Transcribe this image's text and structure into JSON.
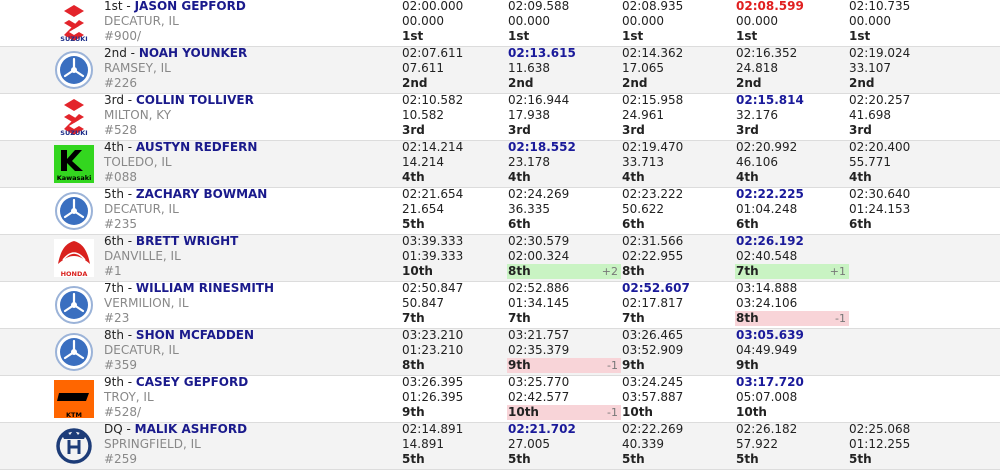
{
  "riders": [
    {
      "pos": "1st",
      "name": "JASON GEPFORD",
      "location": "DECATUR, IL",
      "number": "#900/",
      "brand": "suzuki",
      "laps": [
        {
          "time": "02:00.000",
          "elapsed": "00.000",
          "place": "1st"
        },
        {
          "time": "02:09.588",
          "elapsed": "00.000",
          "place": "1st"
        },
        {
          "time": "02:08.935",
          "elapsed": "00.000",
          "place": "1st"
        },
        {
          "time": "02:08.599",
          "elapsed": "00.000",
          "place": "1st",
          "fastest": true
        },
        {
          "time": "02:10.735",
          "elapsed": "00.000",
          "place": "1st"
        }
      ]
    },
    {
      "pos": "2nd",
      "name": "NOAH YOUNKER",
      "location": "RAMSEY, IL",
      "number": "#226",
      "brand": "yamaha",
      "laps": [
        {
          "time": "02:07.611",
          "elapsed": "07.611",
          "place": "2nd"
        },
        {
          "time": "02:13.615",
          "elapsed": "11.638",
          "place": "2nd",
          "best": true
        },
        {
          "time": "02:14.362",
          "elapsed": "17.065",
          "place": "2nd"
        },
        {
          "time": "02:16.352",
          "elapsed": "24.818",
          "place": "2nd"
        },
        {
          "time": "02:19.024",
          "elapsed": "33.107",
          "place": "2nd"
        }
      ]
    },
    {
      "pos": "3rd",
      "name": "COLLIN TOLLIVER",
      "location": "MILTON, KY",
      "number": "#528",
      "brand": "suzuki",
      "laps": [
        {
          "time": "02:10.582",
          "elapsed": "10.582",
          "place": "3rd"
        },
        {
          "time": "02:16.944",
          "elapsed": "17.938",
          "place": "3rd"
        },
        {
          "time": "02:15.958",
          "elapsed": "24.961",
          "place": "3rd"
        },
        {
          "time": "02:15.814",
          "elapsed": "32.176",
          "place": "3rd",
          "best": true
        },
        {
          "time": "02:20.257",
          "elapsed": "41.698",
          "place": "3rd"
        }
      ]
    },
    {
      "pos": "4th",
      "name": "AUSTYN REDFERN",
      "location": "TOLEDO, IL",
      "number": "#088",
      "brand": "kawasaki",
      "laps": [
        {
          "time": "02:14.214",
          "elapsed": "14.214",
          "place": "4th"
        },
        {
          "time": "02:18.552",
          "elapsed": "23.178",
          "place": "4th",
          "best": true
        },
        {
          "time": "02:19.470",
          "elapsed": "33.713",
          "place": "4th"
        },
        {
          "time": "02:20.992",
          "elapsed": "46.106",
          "place": "4th"
        },
        {
          "time": "02:20.400",
          "elapsed": "55.771",
          "place": "4th"
        }
      ]
    },
    {
      "pos": "5th",
      "name": "ZACHARY BOWMAN",
      "location": "DECATUR, IL",
      "number": "#235",
      "brand": "yamaha",
      "laps": [
        {
          "time": "02:21.654",
          "elapsed": "21.654",
          "place": "5th"
        },
        {
          "time": "02:24.269",
          "elapsed": "36.335",
          "place": "6th"
        },
        {
          "time": "02:23.222",
          "elapsed": "50.622",
          "place": "6th"
        },
        {
          "time": "02:22.225",
          "elapsed": "01:04.248",
          "place": "6th",
          "best": true
        },
        {
          "time": "02:30.640",
          "elapsed": "01:24.153",
          "place": "6th"
        }
      ]
    },
    {
      "pos": "6th",
      "name": "BRETT WRIGHT",
      "location": "DANVILLE, IL",
      "number": "#1",
      "brand": "honda",
      "laps": [
        {
          "time": "03:39.333",
          "elapsed": "01:39.333",
          "place": "10th"
        },
        {
          "time": "02:30.579",
          "elapsed": "02:00.324",
          "place": "8th",
          "change": "+2",
          "dir": "up"
        },
        {
          "time": "02:31.566",
          "elapsed": "02:22.955",
          "place": "8th"
        },
        {
          "time": "02:26.192",
          "elapsed": "02:40.548",
          "place": "7th",
          "change": "+1",
          "dir": "up",
          "best": true
        }
      ]
    },
    {
      "pos": "7th",
      "name": "WILLIAM RINESMITH",
      "location": "VERMILION, IL",
      "number": "#23",
      "brand": "yamaha",
      "laps": [
        {
          "time": "02:50.847",
          "elapsed": "50.847",
          "place": "7th"
        },
        {
          "time": "02:52.886",
          "elapsed": "01:34.145",
          "place": "7th"
        },
        {
          "time": "02:52.607",
          "elapsed": "02:17.817",
          "place": "7th",
          "best": true
        },
        {
          "time": "03:14.888",
          "elapsed": "03:24.106",
          "place": "8th",
          "change": "-1",
          "dir": "down"
        }
      ]
    },
    {
      "pos": "8th",
      "name": "SHON MCFADDEN",
      "location": "DECATUR, IL",
      "number": "#359",
      "brand": "yamaha",
      "laps": [
        {
          "time": "03:23.210",
          "elapsed": "01:23.210",
          "place": "8th"
        },
        {
          "time": "03:21.757",
          "elapsed": "02:35.379",
          "place": "9th",
          "change": "-1",
          "dir": "down"
        },
        {
          "time": "03:26.465",
          "elapsed": "03:52.909",
          "place": "9th"
        },
        {
          "time": "03:05.639",
          "elapsed": "04:49.949",
          "place": "9th",
          "best": true
        }
      ]
    },
    {
      "pos": "9th",
      "name": "CASEY GEPFORD",
      "location": "TROY, IL",
      "number": "#528/",
      "brand": "ktm",
      "laps": [
        {
          "time": "03:26.395",
          "elapsed": "01:26.395",
          "place": "9th"
        },
        {
          "time": "03:25.770",
          "elapsed": "02:42.577",
          "place": "10th",
          "change": "-1",
          "dir": "down"
        },
        {
          "time": "03:24.245",
          "elapsed": "03:57.887",
          "place": "10th"
        },
        {
          "time": "03:17.720",
          "elapsed": "05:07.008",
          "place": "10th",
          "best": true
        }
      ]
    },
    {
      "pos": "DQ",
      "name": "MALIK ASHFORD",
      "location": "SPRINGFIELD, IL",
      "number": "#259",
      "brand": "husqvarna",
      "laps": [
        {
          "time": "02:14.891",
          "elapsed": "14.891",
          "place": "5th"
        },
        {
          "time": "02:21.702",
          "elapsed": "27.005",
          "place": "5th",
          "best": true
        },
        {
          "time": "02:22.269",
          "elapsed": "40.339",
          "place": "5th"
        },
        {
          "time": "02:26.182",
          "elapsed": "57.922",
          "place": "5th"
        },
        {
          "time": "02:25.068",
          "elapsed": "01:12.255",
          "place": "5th"
        }
      ]
    }
  ],
  "logos": {
    "suzuki": {
      "label": "SUZUKI",
      "color": "#e3242b"
    },
    "yamaha": {
      "label": "",
      "color": "#3a6fc0"
    },
    "kawasaki": {
      "label": "Kawasaki",
      "color": "#33d61f"
    },
    "honda": {
      "label": "HONDA",
      "color": "#d9211e"
    },
    "ktm": {
      "label": "KTM",
      "color": "#ff6600"
    },
    "husqvarna": {
      "label": "",
      "color": "#1d3c78"
    }
  }
}
